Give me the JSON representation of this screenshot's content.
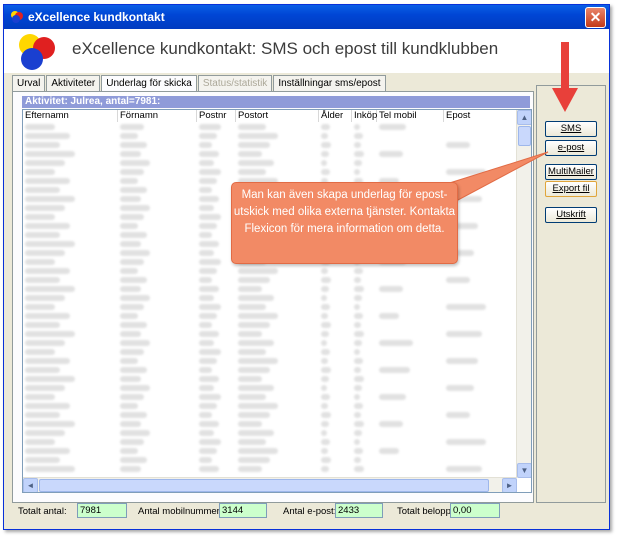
{
  "window": {
    "title": "eXcellence kundkontakt"
  },
  "header": {
    "title": "eXcellence kundkontakt: SMS och epost till kundklubben"
  },
  "tabs": [
    {
      "label": "Urval"
    },
    {
      "label": "Aktiviteter"
    },
    {
      "label": "Underlag för skicka"
    },
    {
      "label": "Status/statistik"
    },
    {
      "label": "Inställningar sms/epost"
    }
  ],
  "activity": {
    "text": "Aktivitet: Julrea, antal=7981:"
  },
  "columns": [
    "Efternamn",
    "Förnamn",
    "Postnr",
    "Postort",
    "Ålder",
    "Inköp",
    "Tel mobil",
    "Epost"
  ],
  "buttons": {
    "sms": "SMS",
    "epost": "e-post",
    "multimailer": "MultiMailer",
    "export": "Export fil",
    "utskrift": "Utskrift"
  },
  "footer": {
    "total_label": "Totalt antal:",
    "total_value": "7981",
    "mobile_label": "Antal mobilnummer:",
    "mobile_value": "3144",
    "email_label": "Antal e-post:",
    "email_value": "2433",
    "amount_label": "Totalt belopp:",
    "amount_value": "0,00"
  },
  "callout": {
    "text": "Man kan även skapa underlag för epost-utskick med olika externa tjänster. Kontakta Flexicon för mera information om detta."
  },
  "colors": {
    "callout": "#f28a65",
    "arrow": "#e8403a",
    "activity_bar": "#8f9bd9",
    "footer_field": "#ccffcc"
  }
}
